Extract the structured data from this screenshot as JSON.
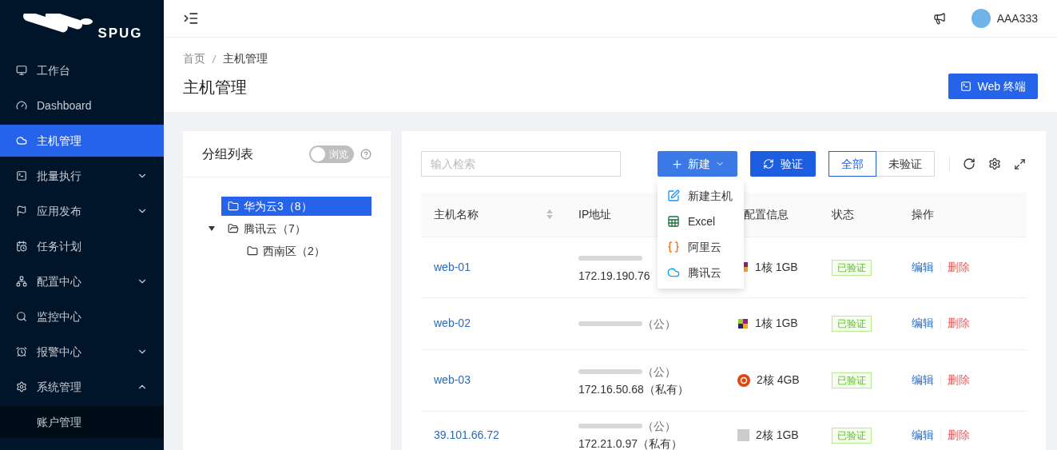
{
  "logo": {
    "text": "SPUG"
  },
  "sidebar": {
    "items": [
      {
        "label": "工作台",
        "selected": false
      },
      {
        "label": "Dashboard",
        "selected": false
      },
      {
        "label": "主机管理",
        "selected": true
      },
      {
        "label": "批量执行",
        "selected": false,
        "expanded": false
      },
      {
        "label": "应用发布",
        "selected": false,
        "expanded": false
      },
      {
        "label": "任务计划",
        "selected": false
      },
      {
        "label": "配置中心",
        "selected": false,
        "expanded": false
      },
      {
        "label": "监控中心",
        "selected": false
      },
      {
        "label": "报警中心",
        "selected": false,
        "expanded": false
      },
      {
        "label": "系统管理",
        "selected": false,
        "expanded": true,
        "children": [
          {
            "label": "账户管理"
          }
        ]
      }
    ]
  },
  "header": {
    "user": "AAA333"
  },
  "breadcrumb": [
    "首页",
    "主机管理"
  ],
  "page_title": "主机管理",
  "web_terminal_button": "Web 终端",
  "group_panel": {
    "title": "分组列表",
    "toggle": {
      "label": "浏览",
      "checked": false
    },
    "tree": [
      {
        "label": "华为云3（8）",
        "selected": true
      },
      {
        "label": "腾讯云（7）",
        "selected": false,
        "expanded": true,
        "children": [
          {
            "label": "西南区（2）",
            "selected": false
          }
        ]
      }
    ]
  },
  "toolbar": {
    "search": {
      "placeholder": "输入检索"
    },
    "new_button": "新建",
    "verify_button": "验证",
    "filters": [
      {
        "label": "全部",
        "selected": true
      },
      {
        "label": "未验证",
        "selected": false
      }
    ]
  },
  "new_menu": [
    "新建主机",
    "Excel",
    "阿里云",
    "腾讯云"
  ],
  "table": {
    "columns": [
      "主机名称",
      "IP地址",
      "配置信息",
      "状态",
      "操作"
    ],
    "rows": [
      {
        "name": "web-01",
        "ip_private": "172.19.190.76",
        "spec": "1核 1GB",
        "status": "已验证",
        "actions": [
          "编辑",
          "删除"
        ]
      },
      {
        "name": "web-02",
        "ip_public": "（公）",
        "spec": "1核 1GB",
        "status": "已验证",
        "actions": [
          "编辑",
          "删除"
        ]
      },
      {
        "name": "web-03",
        "ip_public": "（公）",
        "ip_private": "172.16.50.68（私有）",
        "spec": "2核 4GB",
        "status": "已验证",
        "actions": [
          "编辑",
          "删除"
        ]
      },
      {
        "name": "39.101.66.72",
        "ip_public": "（公）",
        "ip_private": "172.21.0.97（私有）",
        "spec": "2核 1GB",
        "status": "已验证",
        "actions": [
          "编辑",
          "删除"
        ]
      }
    ]
  }
}
